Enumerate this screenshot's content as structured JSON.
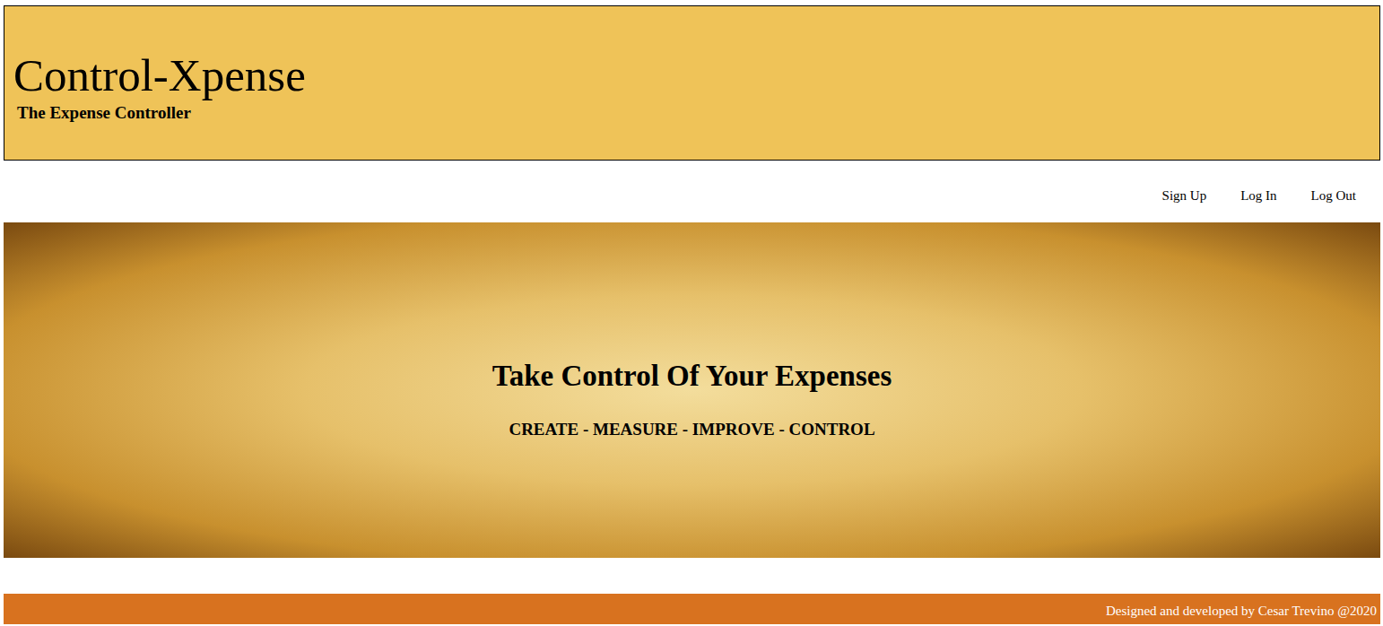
{
  "header": {
    "title": "Control-Xpense",
    "subtitle": "The Expense Controller"
  },
  "nav": {
    "items": [
      {
        "label": "Sign Up"
      },
      {
        "label": "Log In"
      },
      {
        "label": "Log Out"
      }
    ]
  },
  "hero": {
    "heading": "Take Control Of Your Expenses",
    "tagline": "CREATE - MEASURE - IMPROVE - CONTROL"
  },
  "footer": {
    "text": "Designed and developed by Cesar Trevino @2020"
  }
}
